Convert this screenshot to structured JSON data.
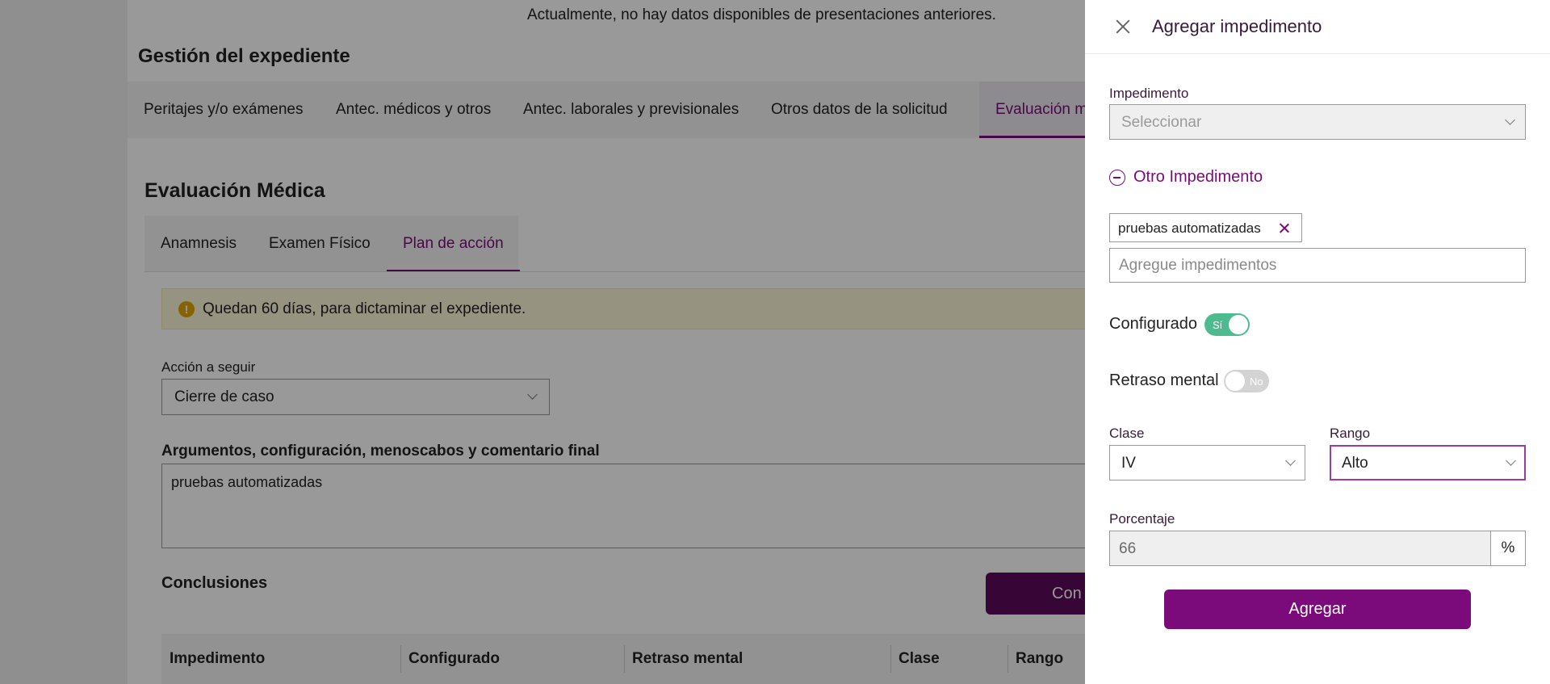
{
  "background": {
    "previous_note": "Actualmente, no hay datos disponibles de presentaciones anteriores.",
    "section_title": "Gestión del expediente",
    "main_tabs": [
      {
        "label": "Peritajes y/o exámenes"
      },
      {
        "label": "Antec. médicos y otros"
      },
      {
        "label": "Antec. laborales y previsionales"
      },
      {
        "label": "Otros datos de la solicitud"
      },
      {
        "label": "Evaluación m",
        "active": true
      }
    ],
    "eval_title": "Evaluación Médica",
    "sub_tabs": [
      {
        "label": "Anamnesis"
      },
      {
        "label": "Examen Físico"
      },
      {
        "label": "Plan de acción",
        "active": true
      }
    ],
    "alert_text": "Quedan 60 días, para dictaminar el expediente.",
    "alert_icon": "!",
    "accion": {
      "label": "Acción a seguir",
      "value": "Cierre de caso"
    },
    "args": {
      "label": "Argumentos, configuración, menoscabos y comentario final",
      "value": "pruebas automatizadas"
    },
    "conclusiones": {
      "label": "Conclusiones",
      "button_label": "Con"
    },
    "table_headers": [
      "Impedimento",
      "Configurado",
      "Retraso mental",
      "Clase",
      "Rango"
    ]
  },
  "drawer": {
    "title": "Agregar impedimento",
    "close_icon": "close-icon",
    "impedimento": {
      "label": "Impedimento",
      "placeholder": "Seleccionar"
    },
    "otro_impedimento": {
      "label": "Otro Impedimento",
      "icon": "minus-circle-icon"
    },
    "chips": [
      {
        "label": "pruebas automatizadas"
      }
    ],
    "agregue": {
      "placeholder": "Agregue impedimentos",
      "value": ""
    },
    "configurado": {
      "label": "Configurado",
      "state_label": "Sí",
      "on": true
    },
    "retraso": {
      "label": "Retraso mental",
      "state_label": "No",
      "on": false
    },
    "clase": {
      "label": "Clase",
      "value": "IV"
    },
    "rango": {
      "label": "Rango",
      "value": "Alto"
    },
    "porcentaje": {
      "label": "Porcentaje",
      "value": "66",
      "suffix": "%"
    },
    "submit_label": "Agregar"
  },
  "colors": {
    "accent": "#7b0a7b",
    "toggle_on": "#4dbb8f",
    "toggle_off": "#d3d3d3",
    "alert_bg": "#fbf6d8",
    "overlay": "rgba(0,0,0,0.4)"
  }
}
